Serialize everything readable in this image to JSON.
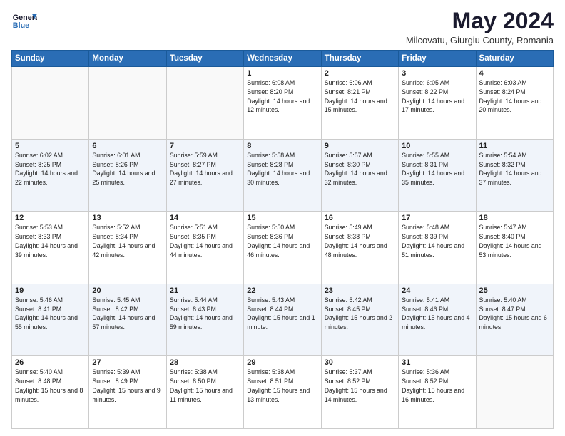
{
  "header": {
    "title": "May 2024",
    "subtitle": "Milcovatu, Giurgiu County, Romania"
  },
  "calendar": {
    "days": [
      "Sunday",
      "Monday",
      "Tuesday",
      "Wednesday",
      "Thursday",
      "Friday",
      "Saturday"
    ],
    "weeks": [
      [
        {
          "day": "",
          "sunrise": "",
          "sunset": "",
          "daylight": ""
        },
        {
          "day": "",
          "sunrise": "",
          "sunset": "",
          "daylight": ""
        },
        {
          "day": "",
          "sunrise": "",
          "sunset": "",
          "daylight": ""
        },
        {
          "day": "1",
          "sunrise": "Sunrise: 6:08 AM",
          "sunset": "Sunset: 8:20 PM",
          "daylight": "Daylight: 14 hours and 12 minutes."
        },
        {
          "day": "2",
          "sunrise": "Sunrise: 6:06 AM",
          "sunset": "Sunset: 8:21 PM",
          "daylight": "Daylight: 14 hours and 15 minutes."
        },
        {
          "day": "3",
          "sunrise": "Sunrise: 6:05 AM",
          "sunset": "Sunset: 8:22 PM",
          "daylight": "Daylight: 14 hours and 17 minutes."
        },
        {
          "day": "4",
          "sunrise": "Sunrise: 6:03 AM",
          "sunset": "Sunset: 8:24 PM",
          "daylight": "Daylight: 14 hours and 20 minutes."
        }
      ],
      [
        {
          "day": "5",
          "sunrise": "Sunrise: 6:02 AM",
          "sunset": "Sunset: 8:25 PM",
          "daylight": "Daylight: 14 hours and 22 minutes."
        },
        {
          "day": "6",
          "sunrise": "Sunrise: 6:01 AM",
          "sunset": "Sunset: 8:26 PM",
          "daylight": "Daylight: 14 hours and 25 minutes."
        },
        {
          "day": "7",
          "sunrise": "Sunrise: 5:59 AM",
          "sunset": "Sunset: 8:27 PM",
          "daylight": "Daylight: 14 hours and 27 minutes."
        },
        {
          "day": "8",
          "sunrise": "Sunrise: 5:58 AM",
          "sunset": "Sunset: 8:28 PM",
          "daylight": "Daylight: 14 hours and 30 minutes."
        },
        {
          "day": "9",
          "sunrise": "Sunrise: 5:57 AM",
          "sunset": "Sunset: 8:30 PM",
          "daylight": "Daylight: 14 hours and 32 minutes."
        },
        {
          "day": "10",
          "sunrise": "Sunrise: 5:55 AM",
          "sunset": "Sunset: 8:31 PM",
          "daylight": "Daylight: 14 hours and 35 minutes."
        },
        {
          "day": "11",
          "sunrise": "Sunrise: 5:54 AM",
          "sunset": "Sunset: 8:32 PM",
          "daylight": "Daylight: 14 hours and 37 minutes."
        }
      ],
      [
        {
          "day": "12",
          "sunrise": "Sunrise: 5:53 AM",
          "sunset": "Sunset: 8:33 PM",
          "daylight": "Daylight: 14 hours and 39 minutes."
        },
        {
          "day": "13",
          "sunrise": "Sunrise: 5:52 AM",
          "sunset": "Sunset: 8:34 PM",
          "daylight": "Daylight: 14 hours and 42 minutes."
        },
        {
          "day": "14",
          "sunrise": "Sunrise: 5:51 AM",
          "sunset": "Sunset: 8:35 PM",
          "daylight": "Daylight: 14 hours and 44 minutes."
        },
        {
          "day": "15",
          "sunrise": "Sunrise: 5:50 AM",
          "sunset": "Sunset: 8:36 PM",
          "daylight": "Daylight: 14 hours and 46 minutes."
        },
        {
          "day": "16",
          "sunrise": "Sunrise: 5:49 AM",
          "sunset": "Sunset: 8:38 PM",
          "daylight": "Daylight: 14 hours and 48 minutes."
        },
        {
          "day": "17",
          "sunrise": "Sunrise: 5:48 AM",
          "sunset": "Sunset: 8:39 PM",
          "daylight": "Daylight: 14 hours and 51 minutes."
        },
        {
          "day": "18",
          "sunrise": "Sunrise: 5:47 AM",
          "sunset": "Sunset: 8:40 PM",
          "daylight": "Daylight: 14 hours and 53 minutes."
        }
      ],
      [
        {
          "day": "19",
          "sunrise": "Sunrise: 5:46 AM",
          "sunset": "Sunset: 8:41 PM",
          "daylight": "Daylight: 14 hours and 55 minutes."
        },
        {
          "day": "20",
          "sunrise": "Sunrise: 5:45 AM",
          "sunset": "Sunset: 8:42 PM",
          "daylight": "Daylight: 14 hours and 57 minutes."
        },
        {
          "day": "21",
          "sunrise": "Sunrise: 5:44 AM",
          "sunset": "Sunset: 8:43 PM",
          "daylight": "Daylight: 14 hours and 59 minutes."
        },
        {
          "day": "22",
          "sunrise": "Sunrise: 5:43 AM",
          "sunset": "Sunset: 8:44 PM",
          "daylight": "Daylight: 15 hours and 1 minute."
        },
        {
          "day": "23",
          "sunrise": "Sunrise: 5:42 AM",
          "sunset": "Sunset: 8:45 PM",
          "daylight": "Daylight: 15 hours and 2 minutes."
        },
        {
          "day": "24",
          "sunrise": "Sunrise: 5:41 AM",
          "sunset": "Sunset: 8:46 PM",
          "daylight": "Daylight: 15 hours and 4 minutes."
        },
        {
          "day": "25",
          "sunrise": "Sunrise: 5:40 AM",
          "sunset": "Sunset: 8:47 PM",
          "daylight": "Daylight: 15 hours and 6 minutes."
        }
      ],
      [
        {
          "day": "26",
          "sunrise": "Sunrise: 5:40 AM",
          "sunset": "Sunset: 8:48 PM",
          "daylight": "Daylight: 15 hours and 8 minutes."
        },
        {
          "day": "27",
          "sunrise": "Sunrise: 5:39 AM",
          "sunset": "Sunset: 8:49 PM",
          "daylight": "Daylight: 15 hours and 9 minutes."
        },
        {
          "day": "28",
          "sunrise": "Sunrise: 5:38 AM",
          "sunset": "Sunset: 8:50 PM",
          "daylight": "Daylight: 15 hours and 11 minutes."
        },
        {
          "day": "29",
          "sunrise": "Sunrise: 5:38 AM",
          "sunset": "Sunset: 8:51 PM",
          "daylight": "Daylight: 15 hours and 13 minutes."
        },
        {
          "day": "30",
          "sunrise": "Sunrise: 5:37 AM",
          "sunset": "Sunset: 8:52 PM",
          "daylight": "Daylight: 15 hours and 14 minutes."
        },
        {
          "day": "31",
          "sunrise": "Sunrise: 5:36 AM",
          "sunset": "Sunset: 8:52 PM",
          "daylight": "Daylight: 15 hours and 16 minutes."
        },
        {
          "day": "",
          "sunrise": "",
          "sunset": "",
          "daylight": ""
        }
      ]
    ]
  }
}
